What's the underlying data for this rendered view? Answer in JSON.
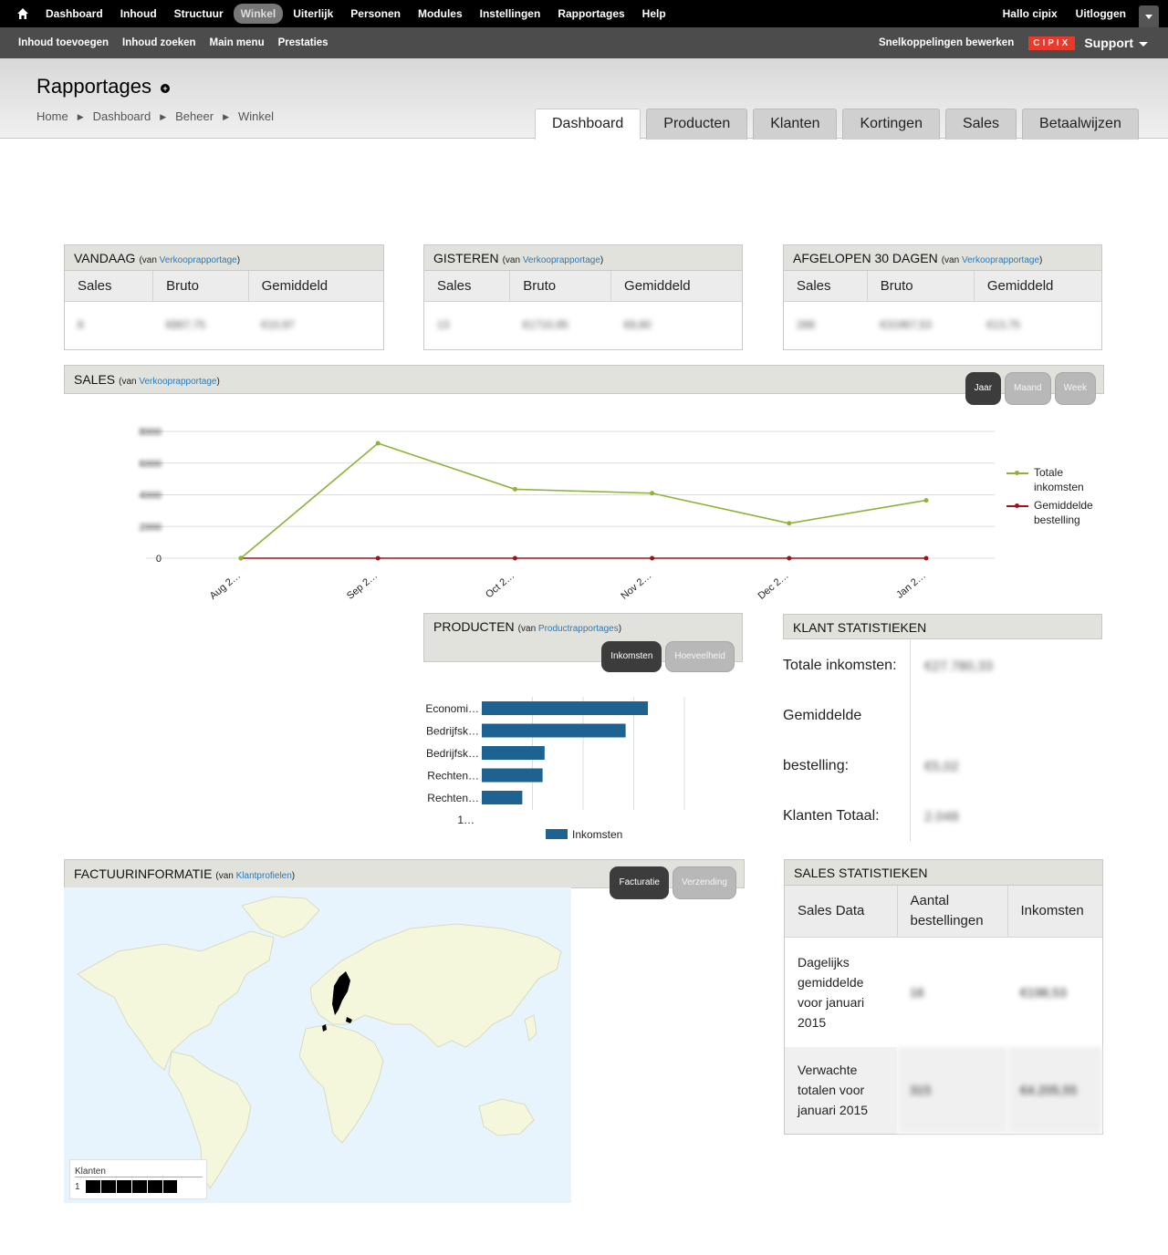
{
  "toolbar": {
    "items": [
      "Dashboard",
      "Inhoud",
      "Structuur",
      "Winkel",
      "Uiterlijk",
      "Personen",
      "Modules",
      "Instellingen",
      "Rapportages",
      "Help"
    ],
    "active": "Winkel",
    "greeting": "Hallo cipix",
    "logout": "Uitloggen"
  },
  "shortcuts": {
    "items": [
      "Inhoud toevoegen",
      "Inhoud zoeken",
      "Main menu",
      "Prestaties"
    ],
    "edit": "Snelkoppelingen bewerken",
    "brand": "CIPIX",
    "support": "Support"
  },
  "header": {
    "title": "Rapportages",
    "breadcrumb": [
      "Home",
      "Dashboard",
      "Beheer",
      "Winkel"
    ],
    "tabs": [
      "Dashboard",
      "Producten",
      "Klanten",
      "Kortingen",
      "Sales",
      "Betaalwijzen"
    ],
    "active_tab": "Dashboard"
  },
  "summary": {
    "source_prefix": "(van ",
    "source_link": "Verkooprapportage",
    "source_suffix": ")",
    "columns": [
      "Sales",
      "Bruto",
      "Gemiddeld"
    ],
    "panels": [
      {
        "title": "VANDAAG",
        "values": [
          "8",
          "€867,75",
          "€10,97"
        ]
      },
      {
        "title": "GISTEREN",
        "values": [
          "13",
          "€1710,95",
          "€8,80"
        ]
      },
      {
        "title": "AFGELOPEN 30 DAGEN",
        "values": [
          "288",
          "€31967,53",
          "€13,75"
        ]
      }
    ]
  },
  "sales": {
    "title": "SALES",
    "source_link": "Verkooprapportage",
    "pills": [
      "Jaar",
      "Maand",
      "Week"
    ],
    "active_pill": "Jaar"
  },
  "chart_data": {
    "type": "line",
    "x": [
      "Aug 2…",
      "Sep 2…",
      "Oct 2…",
      "Nov 2…",
      "Dec 2…",
      "Jan 2…"
    ],
    "yticks": [
      "8000",
      "6000",
      "4000",
      "2000",
      "0"
    ],
    "ylim": [
      0,
      8000
    ],
    "series": [
      {
        "name": "Totale inkomsten",
        "color": "#8db23a",
        "values": [
          0,
          7250,
          4350,
          4100,
          2200,
          3650
        ]
      },
      {
        "name": "Gemiddelde bestelling",
        "color": "#a0121a",
        "values": [
          0,
          0,
          0,
          0,
          0,
          0
        ]
      }
    ],
    "legend": "right"
  },
  "producten": {
    "title": "PRODUCTEN",
    "source_link": "Productrapportages",
    "pills": [
      "Inkomsten",
      "Hoeveelheid"
    ],
    "active_pill": "Inkomsten",
    "chart": {
      "type": "bar",
      "categories": [
        "Economi…",
        "Bedrijfsk…",
        "Bedrijfsk…",
        "Rechten…",
        "Rechten…"
      ],
      "values": [
        8200,
        7100,
        3100,
        3000,
        2000
      ],
      "xlim": [
        0,
        10000
      ],
      "xtick_first": "1…",
      "series_name": "Inkomsten",
      "color": "#1d6290"
    }
  },
  "klant": {
    "title": "KLANT STATISTIEKEN",
    "labels": [
      "Totale inkomsten:",
      "Gemiddelde",
      "bestelling:",
      "Klanten Totaal:"
    ],
    "values": [
      "€27.780,33",
      "€5,02",
      "2.048"
    ]
  },
  "factuur": {
    "title": "FACTUURINFORMATIE",
    "source_link": "Klantprofielen",
    "pills": [
      "Facturatie",
      "Verzending"
    ],
    "active_pill": "Facturatie",
    "legend_label": "Klanten",
    "legend_min": "1"
  },
  "salesstat": {
    "title": "SALES STATISTIEKEN",
    "columns": [
      "Sales Data",
      "Aantal bestellingen",
      "Inkomsten"
    ],
    "rows": [
      {
        "label": "Dagelijks gemiddelde voor januari 2015",
        "count": "16",
        "income": "€198,53"
      },
      {
        "label": "Verwachte totalen voor januari 2015",
        "count": "315",
        "income": "€4.205,55"
      }
    ]
  }
}
